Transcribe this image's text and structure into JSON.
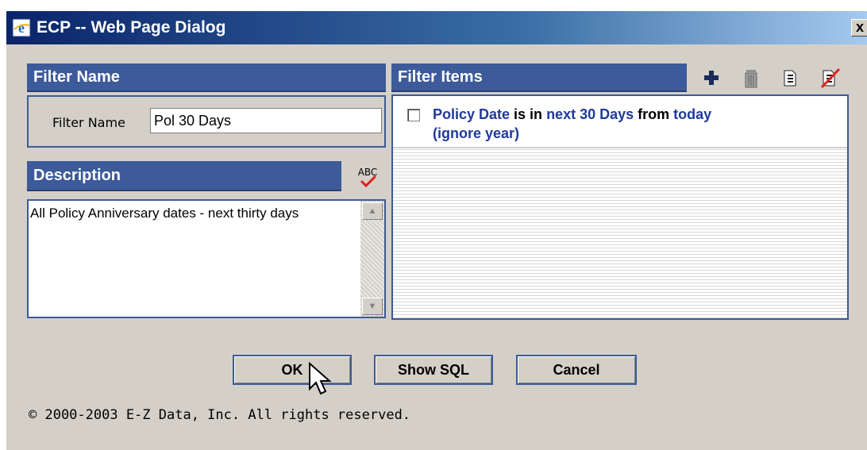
{
  "window": {
    "title": "ECP -- Web Page Dialog",
    "close_label": "x"
  },
  "filter_name": {
    "header": "Filter Name",
    "field_label": "Filter Name",
    "field_value": "Pol 30 Days"
  },
  "description": {
    "header": "Description",
    "text": "All Policy Anniversary dates - next thirty days",
    "spellcheck_icon_label": "ABC"
  },
  "filter_items": {
    "header": "Filter Items",
    "toolbar_icons": [
      "add-icon",
      "trash-icon",
      "edit-icon",
      "clear-icon"
    ],
    "items": [
      {
        "field": "Policy Date",
        "op1": " is in ",
        "value": "next 30 Days",
        "op2": " from ",
        "ref": "today",
        "modifier": "(ignore year)",
        "checked": false
      }
    ]
  },
  "buttons": {
    "ok": "OK",
    "show_sql": "Show SQL",
    "cancel": "Cancel"
  },
  "footer": {
    "copyright": "© 2000-2003 E-Z Data, Inc. All rights reserved."
  },
  "colors": {
    "header_bg": "#3d5a9a",
    "keyword": "#1f3a9a",
    "dialog_bg": "#d4d0c8"
  }
}
